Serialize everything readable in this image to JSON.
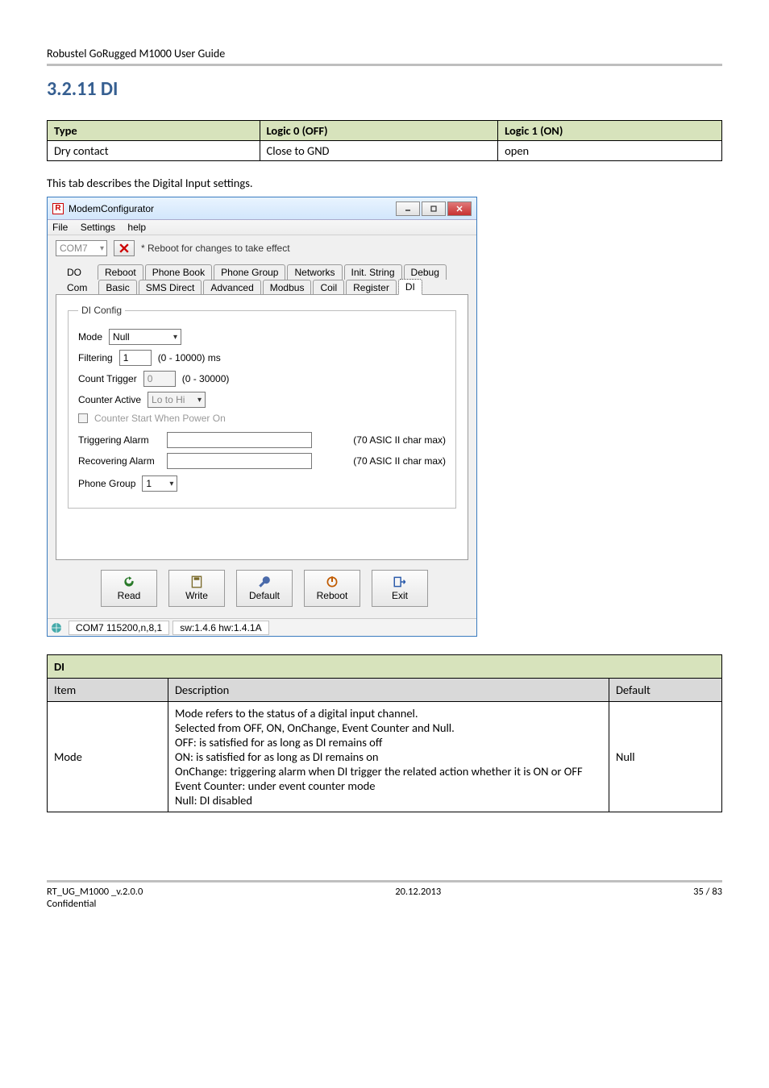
{
  "doc": {
    "running_head": "Robustel GoRugged M1000 User Guide",
    "section_title": "3.2.11  DI",
    "tab_desc": "This tab describes the Digital Input settings."
  },
  "type_table": {
    "headers": {
      "type": "Type",
      "l0": "Logic 0 (OFF)",
      "l1": "Logic 1 (ON)"
    },
    "row": {
      "type": "Dry contact",
      "l0": "Close to GND",
      "l1": "open"
    }
  },
  "app": {
    "title": "ModemConfigurator",
    "menu": {
      "file": "File",
      "settings": "Settings",
      "help": "help"
    },
    "com_select": "COM7",
    "reboot_note": "* Reboot for changes to take effect",
    "tabs_row1_lead": "DO",
    "tabs_row2_lead": "Com",
    "tabs_row1": [
      "Reboot",
      "Phone Book",
      "Phone Group",
      "Networks",
      "Init. String",
      "Debug"
    ],
    "tabs_row2": [
      "Basic",
      "SMS Direct",
      "Advanced",
      "Modbus",
      "Coil",
      "Register",
      "DI"
    ],
    "tabs_row2_selected_index": 6,
    "group_legend": "DI Config",
    "mode_label": "Mode",
    "mode_value": "Null",
    "filtering_label": "Filtering",
    "filtering_value": "1",
    "filtering_units": "(0 - 10000) ms",
    "count_trigger_label": "Count Trigger",
    "count_trigger_value": "0",
    "count_trigger_units": "(0 - 30000)",
    "counter_active_label": "Counter Active",
    "counter_active_value": "Lo to Hi",
    "counter_start_label": "Counter Start When Power On",
    "trig_alarm_label": "Triggering Alarm",
    "rec_alarm_label": "Recovering Alarm",
    "asic_note": "(70 ASIC II char max)",
    "phone_group_label": "Phone Group",
    "phone_group_value": "1",
    "btn_read": "Read",
    "btn_write": "Write",
    "btn_default": "Default",
    "btn_reboot": "Reboot",
    "btn_exit": "Exit",
    "status_com": "COM7 115200,n,8,1",
    "status_sw": "sw:1.4.6 hw:1.4.1A"
  },
  "di_table": {
    "title": "DI",
    "cols": {
      "item": "Item",
      "desc": "Description",
      "default": "Default"
    },
    "row": {
      "item": "Mode",
      "default": "Null",
      "desc_lines": [
        "Mode refers to the status of a digital input channel.",
        "Selected from OFF, ON, OnChange, Event Counter and Null.",
        "OFF: is satisfied for as long as DI remains off",
        "ON: is satisfied for as long as DI remains on",
        "OnChange: triggering alarm when DI trigger the related action whether it is ON or OFF",
        "Event Counter: under event counter mode",
        "Null: DI disabled"
      ]
    }
  },
  "footer": {
    "left1": "RT_UG_M1000 _v.2.0.0",
    "left2": "Confidential",
    "center": "20.12.2013",
    "right": "35 / 83"
  }
}
